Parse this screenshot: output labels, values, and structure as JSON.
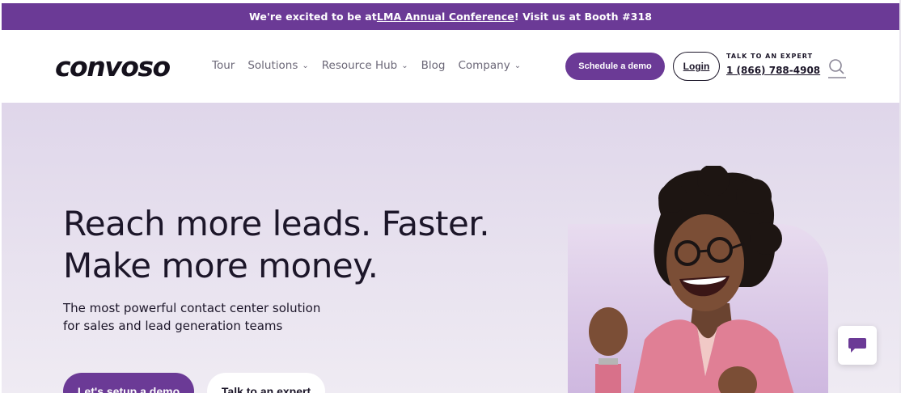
{
  "announcement": {
    "prefix": "We're excited to be at ",
    "link": "LMA Annual Conference",
    "suffix": "! Visit us at Booth #318"
  },
  "header": {
    "logo": "convoso",
    "nav": [
      {
        "label": "Tour",
        "dropdown": false
      },
      {
        "label": "Solutions",
        "dropdown": true
      },
      {
        "label": "Resource Hub",
        "dropdown": true
      },
      {
        "label": "Blog",
        "dropdown": false
      },
      {
        "label": "Company",
        "dropdown": true
      }
    ],
    "schedule_label": "Schedule a demo",
    "login_label": "Login",
    "expert_label": "TALK TO AN EXPERT",
    "expert_phone": "1 (866) 788-4908",
    "search_icon": "search-icon"
  },
  "hero": {
    "headline_line1": "Reach more leads. Faster.",
    "headline_line2": "Make more money.",
    "sub_line1": "The most powerful contact center solution",
    "sub_line2": "for sales and lead generation teams",
    "primary_cta": "Let's setup a demo",
    "secondary_cta": "Talk to an expert"
  },
  "chat": {
    "icon": "chat-bubble-icon"
  },
  "colors": {
    "brand_purple": "#6b3a96",
    "hero_bg": "#e4dced",
    "text_dark": "#1c1629"
  }
}
